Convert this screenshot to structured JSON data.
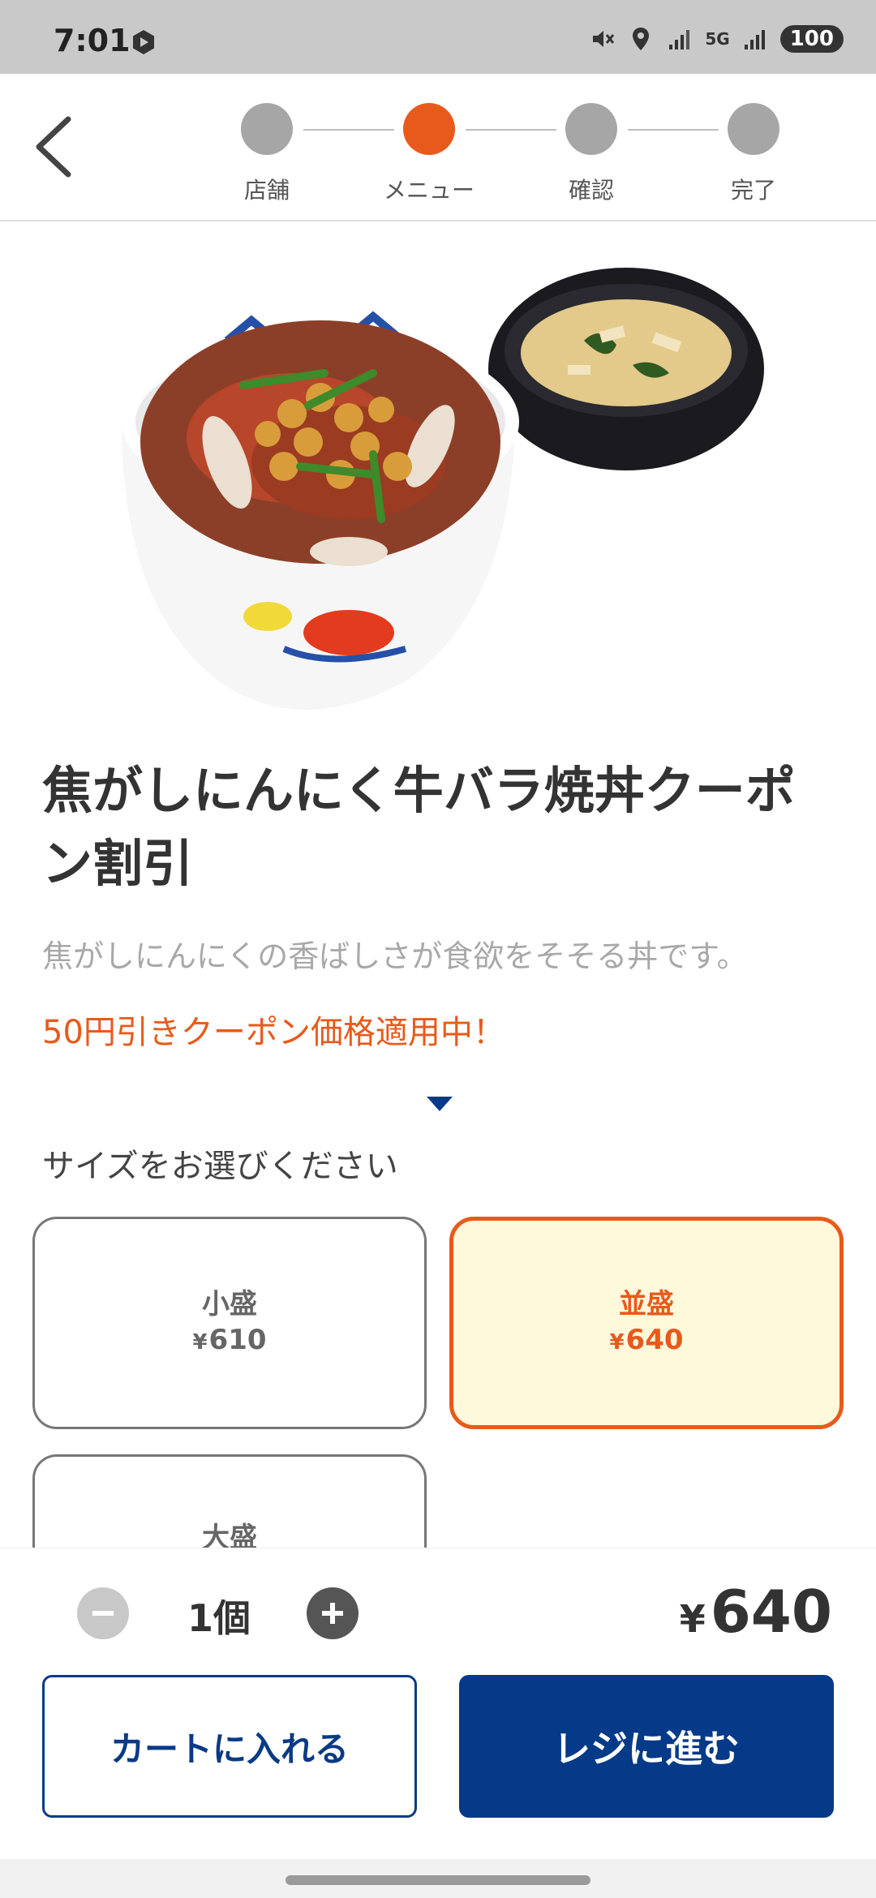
{
  "status_bar": {
    "time": "7:01",
    "network": "5G",
    "battery": "100",
    "icons": [
      "hexagon-app-icon",
      "mute-icon",
      "location-icon",
      "signal-icon",
      "signal-icon"
    ]
  },
  "header": {
    "back_icon": "chevron-left-icon",
    "steps": [
      {
        "label": "店舗",
        "active": false
      },
      {
        "label": "メニュー",
        "active": true
      },
      {
        "label": "確認",
        "active": false
      },
      {
        "label": "完了",
        "active": false
      }
    ]
  },
  "product": {
    "title": "焦がしにんにく牛バラ焼丼クーポン割引",
    "description": "焦がしにんにくの香ばしさが食欲をそそる丼です。",
    "coupon_note": "50円引きクーポン価格適用中！"
  },
  "size": {
    "heading": "サイズをお選びください",
    "options": [
      {
        "name": "小盛",
        "currency": "¥",
        "price": "610",
        "selected": false
      },
      {
        "name": "並盛",
        "currency": "¥",
        "price": "640",
        "selected": true
      },
      {
        "name": "大盛",
        "currency": "",
        "price": "",
        "selected": false
      }
    ]
  },
  "order": {
    "quantity": "1個",
    "currency": "¥",
    "total": "640",
    "add_to_cart": "カートに入れる",
    "checkout": "レジに進む"
  },
  "colors": {
    "accent": "#e85a1b",
    "brand": "#053a88",
    "selected_bg": "#fff9dc"
  }
}
